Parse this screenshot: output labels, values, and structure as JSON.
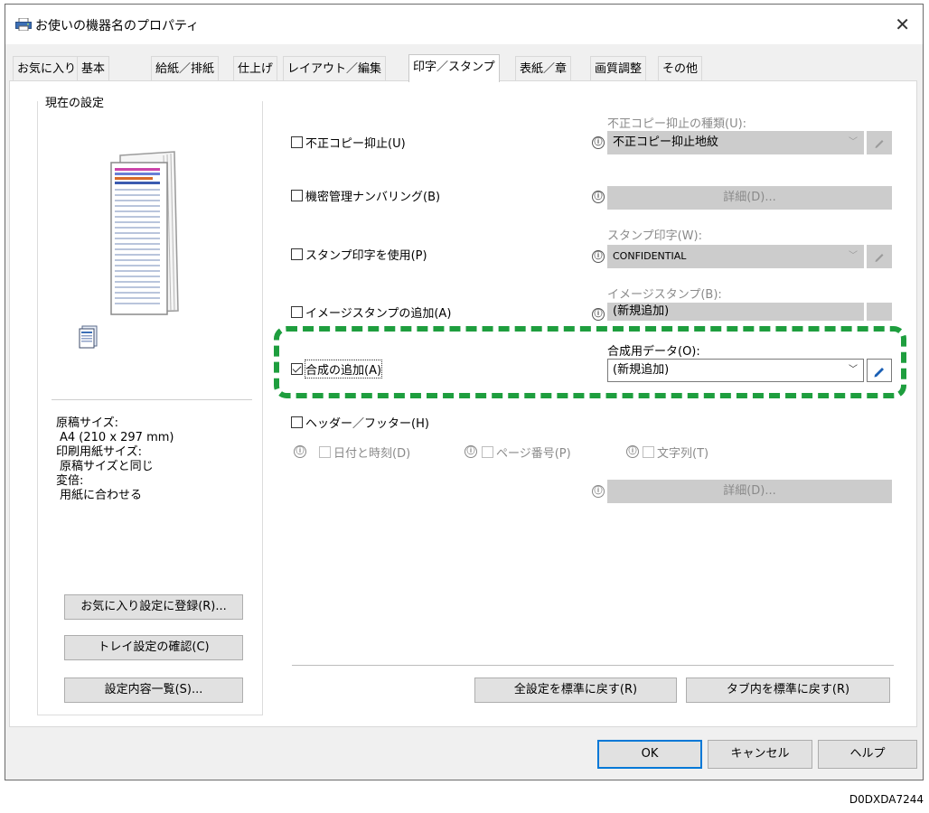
{
  "window": {
    "title": "お使いの機器名のプロパティ",
    "close_glyph": "✕"
  },
  "tabs": [
    {
      "label": "お気に入り",
      "active": false
    },
    {
      "label": "基本",
      "active": false
    },
    {
      "label": "給紙／排紙",
      "active": false
    },
    {
      "label": "仕上げ",
      "active": false
    },
    {
      "label": "レイアウト／編集",
      "active": false
    },
    {
      "label": "印字／スタンプ",
      "active": true
    },
    {
      "label": "表紙／章",
      "active": false
    },
    {
      "label": "画質調整",
      "active": false
    },
    {
      "label": "その他",
      "active": false
    }
  ],
  "left_panel": {
    "group_label": "現在の設定",
    "settings": [
      {
        "label": "原稿サイズ:",
        "value": "A4 (210 x 297 mm)"
      },
      {
        "label": "印刷用紙サイズ:",
        "value": "原稿サイズと同じ"
      },
      {
        "label": "変倍:",
        "value": "用紙に合わせる"
      }
    ],
    "buttons": {
      "register_favorite": "お気に入り設定に登録(R)...",
      "tray_check": "トレイ設定の確認(C)",
      "settings_list": "設定内容一覧(S)..."
    }
  },
  "options": {
    "copy_guard": {
      "label": "不正コピー抑止(U)",
      "checked": false
    },
    "copy_guard_type": {
      "label": "不正コピー抑止の種類(U):",
      "value": "不正コピー抑止地紋"
    },
    "confidential_numbering": {
      "label": "機密管理ナンバリング(B)",
      "checked": false
    },
    "numbering_details": "詳細(D)...",
    "use_stamp": {
      "label": "スタンプ印字を使用(P)",
      "checked": false
    },
    "stamp_print": {
      "label": "スタンプ印字(W):",
      "value": "CONFIDENTIAL"
    },
    "image_stamp": {
      "label": "イメージスタンプの追加(A)",
      "checked": false
    },
    "image_stamp_select": {
      "label": "イメージスタンプ(B):",
      "value": "(新規追加)"
    },
    "overlay": {
      "label": "合成の追加(A)",
      "checked": true
    },
    "overlay_data": {
      "label": "合成用データ(O):",
      "value": "(新規追加)"
    },
    "header_footer": {
      "label": "ヘッダー／フッター(H)",
      "checked": false
    },
    "date_time": {
      "label": "日付と時刻(D)",
      "checked": false
    },
    "page_number": {
      "label": "ページ番号(P)",
      "checked": false
    },
    "text_string": {
      "label": "文字列(T)",
      "checked": false
    },
    "header_details": "詳細(D)..."
  },
  "bottom_buttons": {
    "reset_all": "全設定を標準に戻す(R)",
    "reset_tab": "タブ内を標準に戻す(R)"
  },
  "dialog_buttons": {
    "ok": "OK",
    "cancel": "キャンセル",
    "help": "ヘルプ"
  },
  "colors": {
    "highlight": "#1e9e3e",
    "default_button_border": "#0078d7",
    "disabled_fill": "#cccccc"
  },
  "icons": {
    "info": "ⓘ",
    "chevron": "﹀"
  },
  "footer_code": "D0DXDA7244"
}
